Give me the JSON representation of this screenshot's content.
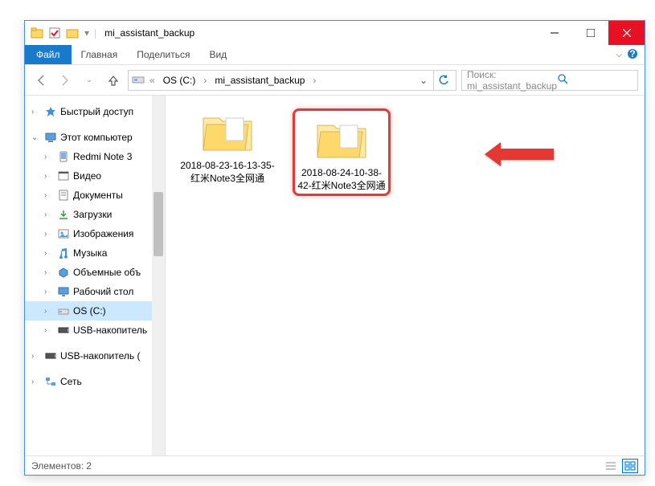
{
  "titlebar": {
    "title": "mi_assistant_backup"
  },
  "menu": {
    "file": "Файл",
    "home": "Главная",
    "share": "Поделиться",
    "view": "Вид"
  },
  "path": {
    "drive": "OS (C:)",
    "folder": "mi_assistant_backup"
  },
  "search": {
    "placeholder": "Поиск: mi_assistant_backup"
  },
  "sidebar": {
    "quick_access": "Быстрый доступ",
    "this_pc": "Этот компьютер",
    "items": [
      "Redmi Note 3",
      "Видео",
      "Документы",
      "Загрузки",
      "Изображения",
      "Музыка",
      "Объемные объ",
      "Рабочий стол",
      "OS (C:)",
      "USB-накопитель"
    ],
    "usb2": "USB-накопитель (",
    "network": "Сеть"
  },
  "folders": [
    {
      "name": "2018-08-23-16-13-35-红米Note3全网通"
    },
    {
      "name": "2018-08-24-10-38-42-红米Note3全网通"
    }
  ],
  "status": {
    "count_label": "Элементов:",
    "count": "2"
  }
}
